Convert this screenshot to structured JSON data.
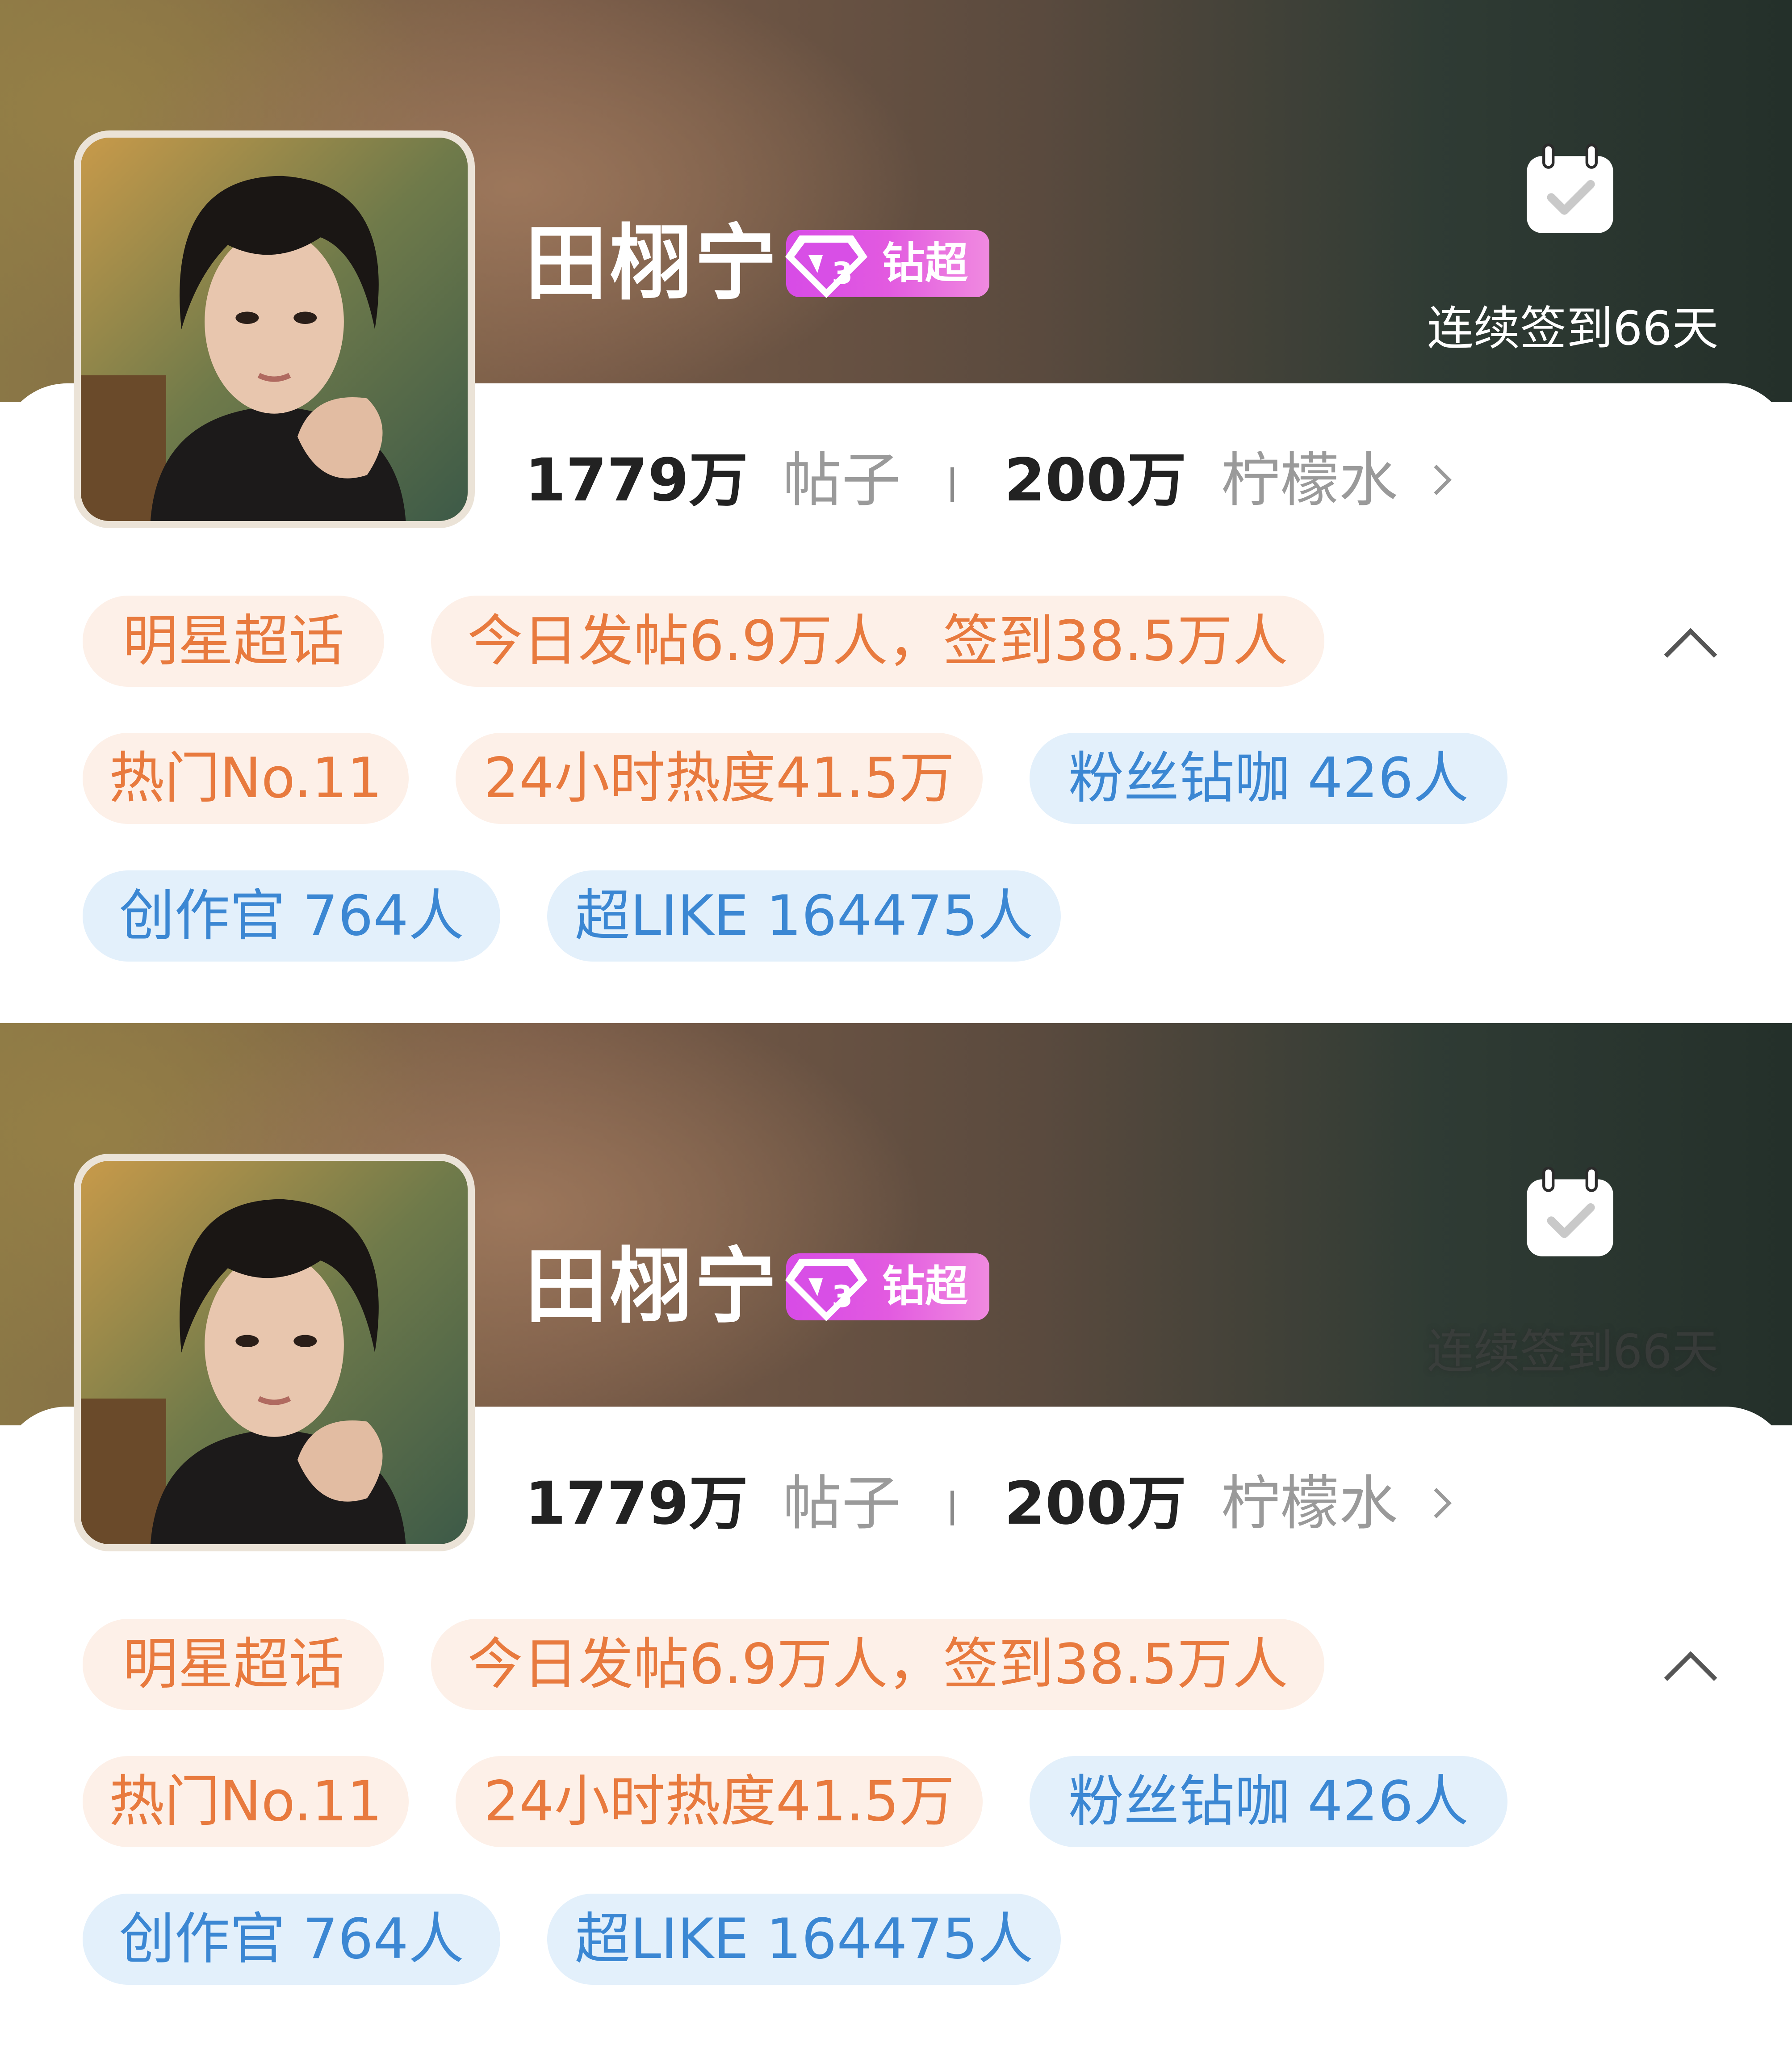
{
  "panels": [
    {
      "name": "田栩宁",
      "badge": "钻超",
      "badge_level": "3",
      "checkin": "连续签到66天",
      "posts_num": "1779万",
      "posts_label": "帖子",
      "lemon_num": "200万",
      "lemon_label": "柠檬水",
      "tags": {
        "category": "明星超话",
        "today": "今日发帖6.9万人，签到38.5万人",
        "hot": "热门No.11",
        "heat": "24小时热度41.5万",
        "fans": "粉丝钻咖 426人",
        "creators": "创作官 764人",
        "superlike": "超LIKE 164475人"
      }
    },
    {
      "name": "田栩宁",
      "badge": "钻超",
      "badge_level": "3",
      "checkin": "连续签到66天",
      "posts_num": "1779万",
      "posts_label": "帖子",
      "lemon_num": "200万",
      "lemon_label": "柠檬水",
      "tags": {
        "category": "明星超话",
        "today": "今日发帖6.9万人，签到38.5万人",
        "hot": "热门No.11",
        "heat": "24小时热度41.5万",
        "fans": "粉丝钻咖 426人",
        "creators": "创作官 764人",
        "superlike": "超LIKE 164475人"
      }
    }
  ],
  "colors": {
    "tag_orange_bg": "#fdf0e8",
    "tag_orange_text": "#e87a3e",
    "tag_blue_bg": "#e3f0fb",
    "tag_blue_text": "#3b87d3",
    "badge": "#d74be6"
  },
  "icons": [
    "calendar-check-icon",
    "diamond-gem-icon",
    "chevron-right-icon",
    "chevron-up-icon"
  ]
}
